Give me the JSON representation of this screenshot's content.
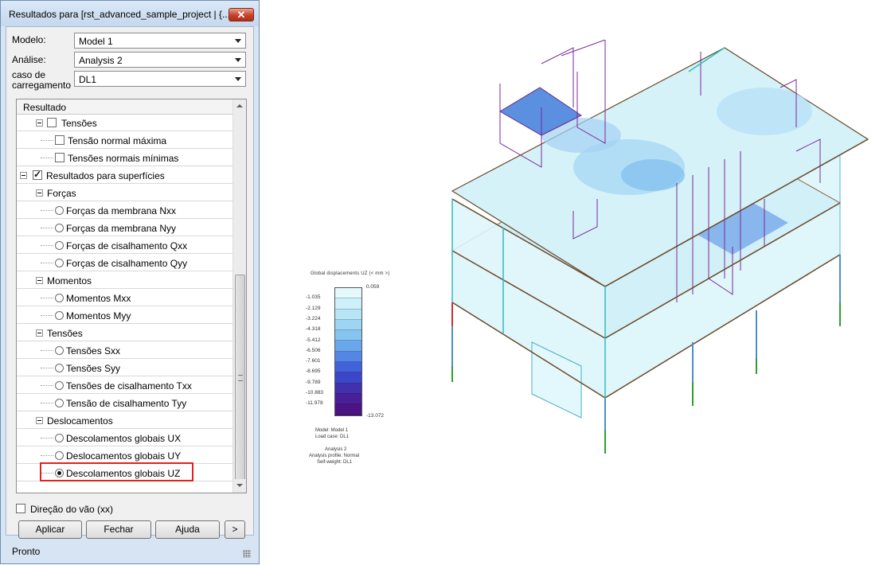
{
  "dialog": {
    "title": "Resultados para [rst_advanced_sample_project | {...",
    "close_label": "✕"
  },
  "fields": {
    "modelo_label": "Modelo:",
    "modelo_value": "Model 1",
    "analise_label": "Análise:",
    "analise_value": "Analysis 2",
    "caso_label_1": "caso de",
    "caso_label_2": "carregamento",
    "caso_value": "DL1"
  },
  "tree": {
    "header": "Resultado",
    "items": [
      {
        "label": "Tensões",
        "kind": "checkbox-group",
        "checked": false
      },
      {
        "label": "Tensão normal máxima",
        "kind": "checkbox",
        "checked": false
      },
      {
        "label": "Tensões normais mínimas",
        "kind": "checkbox",
        "checked": false
      },
      {
        "label": "Resultados para superfícies",
        "kind": "checkbox-group",
        "checked": true
      },
      {
        "label": "Forças",
        "kind": "group"
      },
      {
        "label": "Forças da membrana  Nxx",
        "kind": "radio",
        "selected": false
      },
      {
        "label": "Forças da membrana Nyy",
        "kind": "radio",
        "selected": false
      },
      {
        "label": "Forças de cisalhamento Qxx",
        "kind": "radio",
        "selected": false
      },
      {
        "label": "Forças de cisalhamento Qyy",
        "kind": "radio",
        "selected": false
      },
      {
        "label": "Momentos",
        "kind": "group"
      },
      {
        "label": "Momentos Mxx",
        "kind": "radio",
        "selected": false
      },
      {
        "label": "Momentos Myy",
        "kind": "radio",
        "selected": false
      },
      {
        "label": "Tensões",
        "kind": "group"
      },
      {
        "label": "Tensões Sxx",
        "kind": "radio",
        "selected": false
      },
      {
        "label": "Tensões Syy",
        "kind": "radio",
        "selected": false
      },
      {
        "label": "Tensões de cisalhamento Txx",
        "kind": "radio",
        "selected": false
      },
      {
        "label": "Tensão de cisalhamento Tyy",
        "kind": "radio",
        "selected": false
      },
      {
        "label": "Deslocamentos",
        "kind": "group"
      },
      {
        "label": "Descolamentos globais UX",
        "kind": "radio",
        "selected": false
      },
      {
        "label": "Deslocamentos globais UY",
        "kind": "radio",
        "selected": false
      },
      {
        "label": "Descolamentos globais UZ",
        "kind": "radio",
        "selected": true
      }
    ]
  },
  "bottom": {
    "direction_label": "Direção do vão (xx)",
    "direction_checked": false,
    "apply": "Aplicar",
    "close": "Fechar",
    "help": "Ajuda",
    "more": ">"
  },
  "status": "Pronto",
  "legend": {
    "title": "Global displacements UZ  (< mm >)",
    "top_value": "0.059",
    "bottom_value": "-13.072",
    "values": [
      "-1.035",
      "-2.129",
      "-3.224",
      "-4.318",
      "-5.412",
      "-6.506",
      "-7.601",
      "-8.695",
      "-9.789",
      "-10.883",
      "-11.978"
    ],
    "colors": [
      "#e3f9fc",
      "#cdf1fa",
      "#b8e6f7",
      "#9dd6f4",
      "#86c4f1",
      "#6aa6ec",
      "#5386e5",
      "#4262db",
      "#3b46c9",
      "#4230ad",
      "#4a1f97",
      "#4c1384"
    ],
    "info_1": "Model: Model 1",
    "info_2": "Load case: DL1",
    "info_3": "Analysis 2",
    "info_4": "Analysis profile: Normal",
    "info_5": "Self-weight: DL1"
  }
}
